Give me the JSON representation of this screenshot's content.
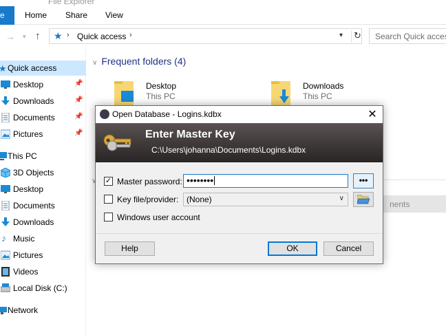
{
  "window": {
    "title_fragment": "File Explorer"
  },
  "ribbon": {
    "file_tab": "e",
    "tabs": [
      "Home",
      "Share",
      "View"
    ]
  },
  "address": {
    "path_label": "Quick access",
    "search_placeholder": "Search Quick access"
  },
  "nav": {
    "quick_access": "Quick access",
    "pinned": [
      {
        "label": "Desktop",
        "icon": "desktop-icon"
      },
      {
        "label": "Downloads",
        "icon": "downloads-icon"
      },
      {
        "label": "Documents",
        "icon": "documents-icon"
      },
      {
        "label": "Pictures",
        "icon": "pictures-icon"
      }
    ],
    "this_pc": "This PC",
    "pc_items": [
      {
        "label": "3D Objects",
        "icon": "3d-objects-icon"
      },
      {
        "label": "Desktop",
        "icon": "desktop-icon"
      },
      {
        "label": "Documents",
        "icon": "documents-icon"
      },
      {
        "label": "Downloads",
        "icon": "downloads-icon"
      },
      {
        "label": "Music",
        "icon": "music-icon"
      },
      {
        "label": "Pictures",
        "icon": "pictures-icon"
      },
      {
        "label": "Videos",
        "icon": "videos-icon"
      },
      {
        "label": "Local Disk (C:)",
        "icon": "drive-icon"
      }
    ],
    "network": "Network"
  },
  "content": {
    "group_title": "Frequent folders (4)",
    "folders": [
      {
        "name": "Desktop",
        "location": "This PC"
      },
      {
        "name": "Downloads",
        "location": "This PC"
      }
    ],
    "recent_column_fragment": "nents"
  },
  "dialog": {
    "title": "Open Database - Logins.kdbx",
    "banner_title": "Enter Master Key",
    "banner_path": "C:\\Users\\johanna\\Documents\\Logins.kdbx",
    "master_password_label": "Master password:",
    "master_password_checked": true,
    "password_mask": "••••••••",
    "show_password_button": "•••",
    "key_file_label": "Key file/provider:",
    "key_file_checked": false,
    "key_file_value": "(None)",
    "windows_account_label": "Windows user account",
    "windows_account_checked": false,
    "help_button": "Help",
    "ok_button": "OK",
    "cancel_button": "Cancel"
  },
  "colors": {
    "accent": "#1979ca",
    "selection": "#cce8ff",
    "banner_dark": "#2a2626"
  }
}
